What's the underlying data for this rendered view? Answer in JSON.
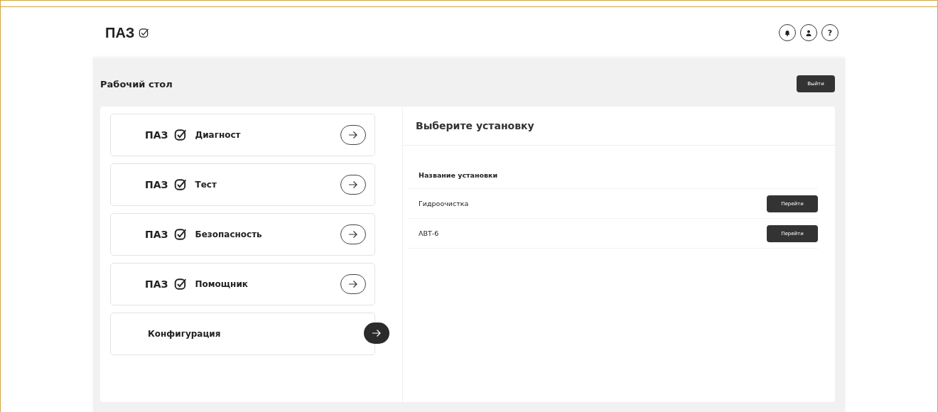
{
  "header": {
    "logo": "ПАЗ"
  },
  "header_buttons": [
    {
      "kind": "bell"
    },
    {
      "kind": "user"
    },
    {
      "kind": "help",
      "label": "?"
    }
  ],
  "toolbar": {
    "title": "Рабочий стол",
    "logout": "Выйти"
  },
  "modules": [
    {
      "kind": "paz",
      "prefix": "ПАЗ",
      "label": "Диагност",
      "highlighted": false
    },
    {
      "kind": "paz",
      "prefix": "ПАЗ",
      "label": "Тест",
      "highlighted": false
    },
    {
      "kind": "paz",
      "prefix": "ПАЗ",
      "label": "Безопасность",
      "highlighted": false
    },
    {
      "kind": "paz",
      "prefix": "ПАЗ",
      "label": "Помощник",
      "highlighted": false
    },
    {
      "kind": "plain",
      "label": "Конфигурация",
      "highlighted": true
    }
  ],
  "panel": {
    "title": "Выберите установку",
    "column": "Название установки",
    "rows": [
      {
        "name": "Гидроочистка",
        "action": "Перейти"
      },
      {
        "name": "АВТ-6",
        "action": "Перейти"
      }
    ]
  }
}
